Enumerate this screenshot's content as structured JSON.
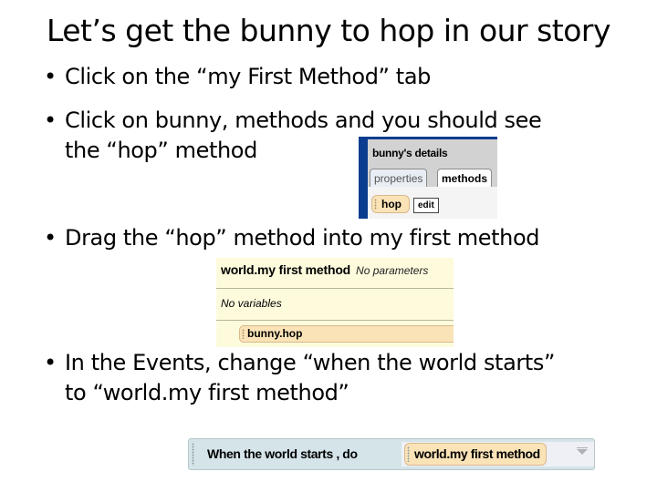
{
  "title": "Let’s get the bunny to hop in our story",
  "bullets": [
    {
      "symbol": "•",
      "lines": [
        "Click on the “my First Method” tab"
      ]
    },
    {
      "symbol": "•",
      "lines": [
        "Click on bunny, methods and you should see",
        "the “hop” method"
      ]
    },
    {
      "symbol": "•",
      "lines": [
        "Drag the “hop” method into my first method"
      ]
    },
    {
      "symbol": "•",
      "lines": [
        "In the Events, change “when the world starts”",
        "to “world.my first method”"
      ]
    }
  ],
  "details_panel": {
    "header": "bunny's details",
    "tabs": [
      {
        "label": "properties",
        "selected": false
      },
      {
        "label": "methods",
        "selected": true
      }
    ],
    "method_tile": "hop",
    "edit_button": "edit",
    "colors": {
      "frame": "#0a3d8f",
      "tile": "#fbe3b8"
    }
  },
  "method_editor": {
    "method_name": "world.my first method",
    "parameters_text": "No parameters",
    "variables_text": "No variables",
    "statements": [
      "bunny.hop"
    ],
    "colors": {
      "background": "#fefbdd",
      "tile": "#fbe3b8"
    }
  },
  "event_block": {
    "label": "When the world starts ,  do",
    "target_method": "world.my first method",
    "dropdown_icon": "chevron-down-icon",
    "colors": {
      "background": "#d4e4e8",
      "tile": "#fbe3b8"
    }
  }
}
